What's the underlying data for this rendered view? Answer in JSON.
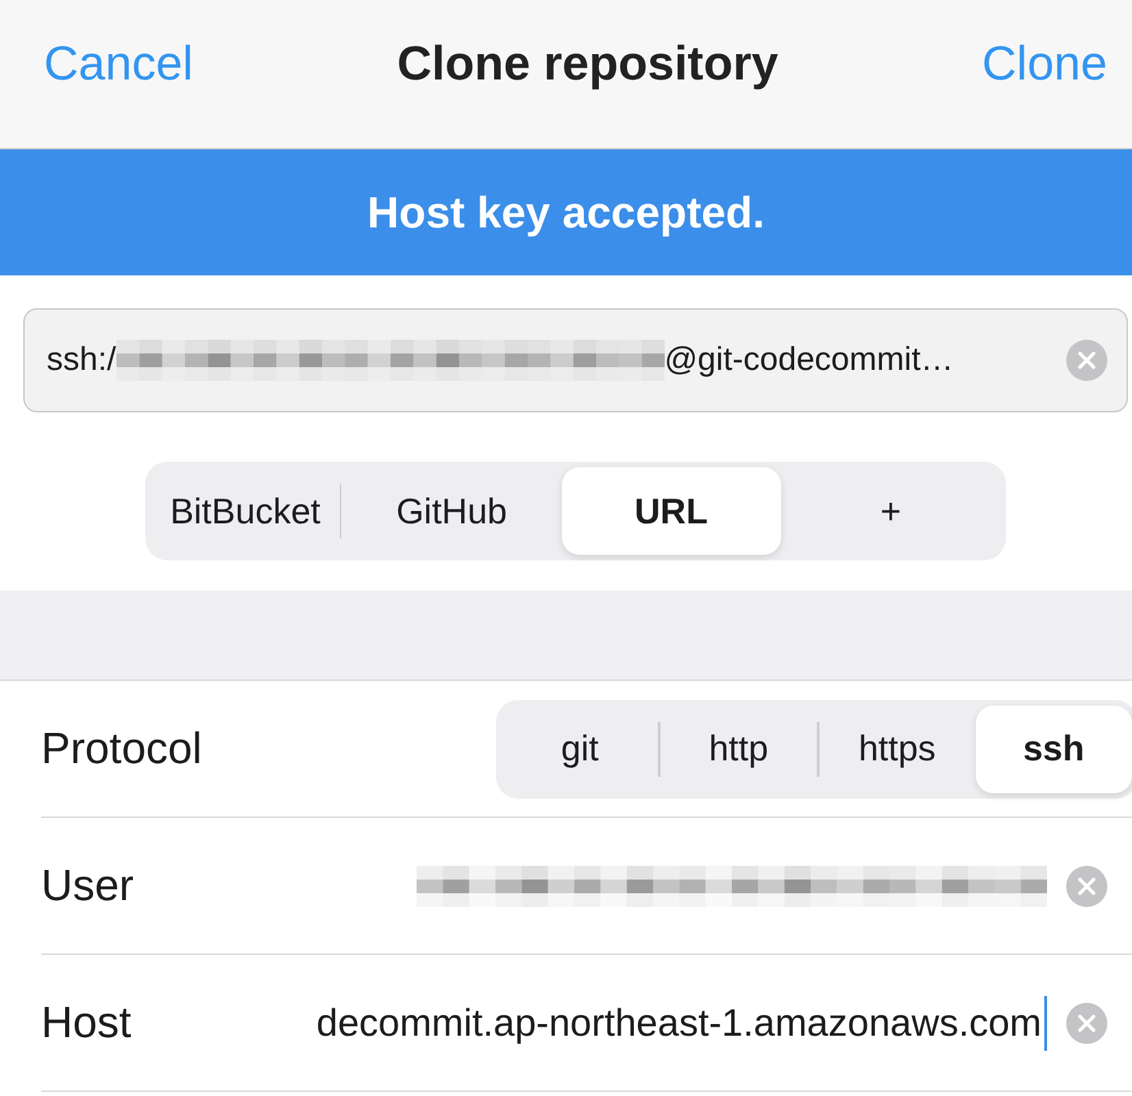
{
  "nav": {
    "cancel": "Cancel",
    "title": "Clone repository",
    "clone": "Clone"
  },
  "banner": "Host key accepted.",
  "url_field": {
    "prefix": "ssh:/",
    "redacted": true,
    "suffix": "@git-codecommit…"
  },
  "source_tabs": [
    {
      "label": "BitBucket",
      "selected": false
    },
    {
      "label": "GitHub",
      "selected": false
    },
    {
      "label": "URL",
      "selected": true
    },
    {
      "label": "+",
      "selected": false
    }
  ],
  "protocol": {
    "label": "Protocol",
    "options": [
      {
        "label": "git",
        "selected": false
      },
      {
        "label": "http",
        "selected": false
      },
      {
        "label": "https",
        "selected": false
      },
      {
        "label": "ssh",
        "selected": true
      }
    ]
  },
  "user": {
    "label": "User",
    "redacted": true
  },
  "host": {
    "label": "Host",
    "value": "decommit.ap-northeast-1.amazonaws.com"
  }
}
